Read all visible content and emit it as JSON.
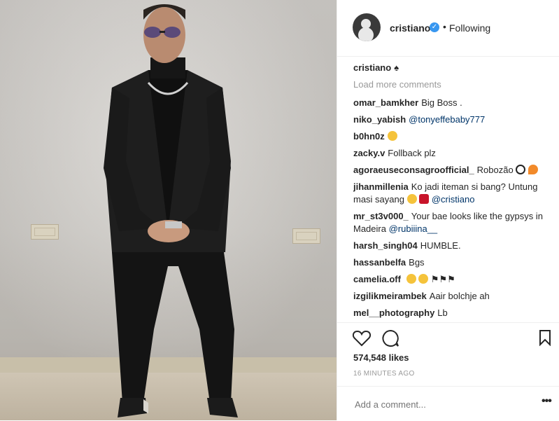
{
  "post_author": {
    "username": "cristiano",
    "separator": "•",
    "follow_status": "Following"
  },
  "caption": {
    "username": "cristiano",
    "text": "♠"
  },
  "load_more": "Load more comments",
  "comments": [
    {
      "user": "omar_bamkher",
      "text": "Big Boss ."
    },
    {
      "user": "niko_yabish",
      "text": "",
      "mention": "@tonyeffebaby777"
    },
    {
      "user": "b0hn0z",
      "text": "",
      "emoji": "confused-face-emoji"
    },
    {
      "user": "zacky.v",
      "text": "Follback plz"
    },
    {
      "user": "agoraeuseconsagroofficial_",
      "text": "Robozão",
      "emoji": "soccer-fire-emoji"
    },
    {
      "user": "jihanmillenia",
      "text": "Ko jadi iteman si bang? Untung masi sayang",
      "mention": "@cristiano"
    },
    {
      "user": "mr_st3v000_",
      "text": "Your bae looks like the gypsys in Madeira",
      "mention": "@rubiiina__"
    },
    {
      "user": "harsh_singh04",
      "text": "HUMBLE."
    },
    {
      "user": "hassanbelfa",
      "text": "Bgs"
    },
    {
      "user": "camelia.off",
      "text": "",
      "emoji": "faces-flags-emoji"
    },
    {
      "user": "izgilikmeirambek",
      "text": "Aair bolchje ah"
    },
    {
      "user": "mel__photography",
      "text": "Lb"
    }
  ],
  "actions": {
    "like_icon": "heart-icon",
    "comment_icon": "comment-icon",
    "save_icon": "bookmark-icon"
  },
  "likes": "574,548 likes",
  "timestamp": "16 MINUTES AGO",
  "add_comment": {
    "placeholder": "Add a comment...",
    "more_label": "•••"
  },
  "colors": {
    "verified": "#3897f0",
    "mention": "#003569",
    "muted": "#999999"
  }
}
